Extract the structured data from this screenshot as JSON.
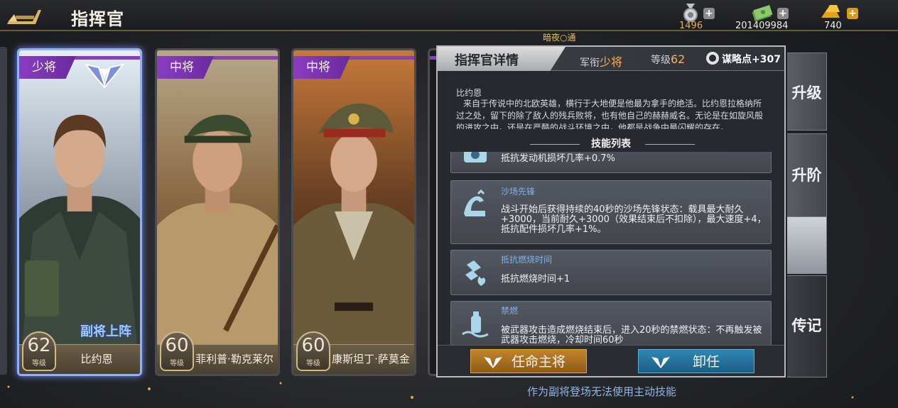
{
  "header": {
    "title": "指挥官",
    "resources": [
      {
        "icon": "medal-icon",
        "value": "1496"
      },
      {
        "icon": "cash-icon",
        "value": "201409984"
      },
      {
        "icon": "gold-bar-icon",
        "value": "740"
      }
    ]
  },
  "night_status": "暗夜○通",
  "cards": [
    {
      "rank": "少将",
      "level": "62",
      "level_label": "等级",
      "name": "比约恩",
      "deputy": "副将上阵",
      "selected": true
    },
    {
      "rank": "中将",
      "level": "60",
      "level_label": "等级",
      "name": "菲利普·勒克莱尔"
    },
    {
      "rank": "中将",
      "level": "60",
      "level_label": "等级",
      "name": "康斯坦丁·萨莫金"
    }
  ],
  "detail": {
    "title": "指挥官详情",
    "rank_label": "军衔",
    "rank_value": "少将",
    "level_label": "等级",
    "level_value": "62",
    "points": "谋略点+307",
    "bio_name": "比约恩",
    "bio_text": "来自于传说中的北欧英雄，横行于大地便是他最为拿手的绝活。比约恩拉格纳所过之处，留下的除了敌人的残兵败将，也有他自己的赫赫威名。无论是在如旋风般的进攻之中，还是在严酷的战斗环境之中，他都是战争中最闪耀的存在。",
    "skills_title": "技能列表",
    "skills": [
      {
        "icon": "engine-shield-icon",
        "name": "",
        "desc": "抵抗发动机损坏几率+0.7%"
      },
      {
        "icon": "vanguard-arm-icon",
        "name": "沙场先锋",
        "desc": "战斗开始后获得持续的40秒的沙场先锋状态：载具最大耐久+3000，当前耐久+3000（效果结束后不扣除），最大速度+4，抵抗配件损坏几率+1%。"
      },
      {
        "icon": "fire-resist-icon",
        "name": "抵抗燃烧时间",
        "desc": "抵抗燃烧时间+1"
      },
      {
        "icon": "extinguisher-icon",
        "name": "禁燃",
        "desc": "被武器攻击造成燃烧结束后，进入20秒的禁燃状态：不再触发被武器攻击燃烧，冷却时间60秒"
      }
    ],
    "appoint_label": "任命主将",
    "dismiss_label": "卸任"
  },
  "side_tabs": {
    "upgrade": "升级",
    "advance": "升阶",
    "biography": "传记"
  },
  "note": "作为副将登场无法使用主动技能",
  "colors": {
    "accent_gold": "#e6b14a",
    "rank_purple": "#8a3cc2",
    "appoint": "#c2842a",
    "dismiss": "#2f87b4",
    "note_blue": "#8db7e6"
  }
}
